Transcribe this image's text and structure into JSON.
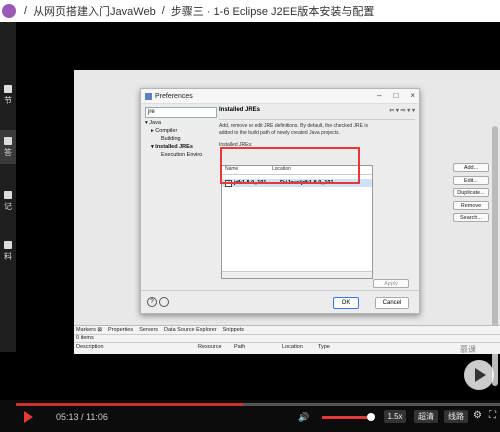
{
  "topbar": {
    "sep1": "/",
    "course": "从网页搭建入门JavaWeb",
    "sep2": "/",
    "lesson": "步骤三 · 1-6 Eclipse J2EE版本安装与配置"
  },
  "sidebar": {
    "items": [
      {
        "label": "节"
      },
      {
        "label": "答"
      },
      {
        "label": "记"
      },
      {
        "label": "料"
      }
    ]
  },
  "dialog": {
    "title": "Preferences",
    "window_buttons": [
      "–",
      "□",
      "×"
    ],
    "filter_value": "jre",
    "tree": {
      "java": "▾ Java",
      "compiler": "▸ Compiler",
      "building": "Building",
      "installed_jres": "▾ Installed JREs",
      "execution": "Execution Enviro"
    },
    "page_title": "Installed JREs",
    "nav_arrows": "⇦ ▾ ⇨ ▾ ▾",
    "description": "Add, remove or edit JRE definitions. By default, the checked JRE is added to the build path of newly created Java projects.",
    "jres_label": "Installed JREs:",
    "table": {
      "col_name": "Name",
      "col_location": "Location",
      "rows": [
        {
          "name": "jdk1.8.0_101...",
          "location": "D:\\Java\\jdk1.8.0_101",
          "checked": "✓"
        }
      ]
    },
    "buttons": {
      "add": "Add...",
      "edit": "Edit...",
      "duplicate": "Duplicate...",
      "remove": "Remove",
      "search": "Search..."
    },
    "apply": "Apply",
    "ok": "OK",
    "cancel": "Cancel",
    "help_icon": "?"
  },
  "bottom_panel": {
    "tabs": [
      "Markers ⊠",
      "Properties",
      "Servers",
      "Data Source Explorer",
      "Snippets"
    ],
    "items_count": "0 items",
    "columns": [
      "Description",
      "Resource",
      "Path",
      "Location",
      "Type"
    ]
  },
  "player": {
    "time": "05:13 / 11:06",
    "progress": 0.47,
    "volume": 0.95,
    "speed": "1.5x",
    "quality": "超清",
    "line": "线路",
    "watermark": "慕课"
  }
}
